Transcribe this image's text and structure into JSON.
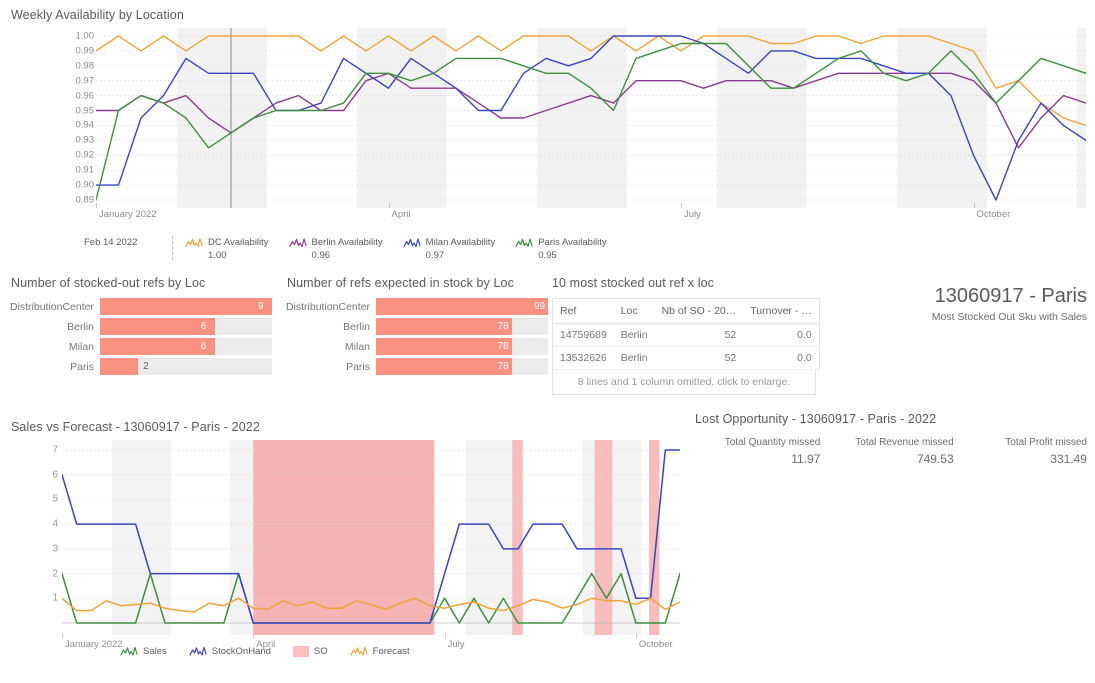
{
  "top_chart": {
    "title": "Weekly Availability by Location",
    "reference_date": "Feb 14 2022",
    "legend": [
      {
        "label": "DC Availability",
        "value": "1.00",
        "color": "#eda53a"
      },
      {
        "label": "Berlin Availability",
        "value": "0.96",
        "color": "#8a3d8f"
      },
      {
        "label": "Milan Availability",
        "value": "0.97",
        "color": "#3b44c4"
      },
      {
        "label": "Paris Availability",
        "value": "0.95",
        "color": "#3f8f3f"
      }
    ],
    "y_ticks": [
      "1.00",
      "0.99",
      "0.98",
      "0.97",
      "0.96",
      "0.95",
      "0.94",
      "0.93",
      "0.92",
      "0.91",
      "0.90",
      "0.89"
    ],
    "x_ticks": [
      "January 2022",
      "April",
      "July",
      "October"
    ]
  },
  "chart_data": [
    {
      "type": "line",
      "title": "Weekly Availability by Location",
      "xlabel": "",
      "ylabel": "",
      "ylim": [
        0.885,
        1.003
      ],
      "grid": true,
      "legend_position": "bottom",
      "x_tick_labels": [
        "January 2022",
        "April",
        "July",
        "October"
      ],
      "x_tick_positions": [
        0,
        13,
        26,
        39
      ],
      "reference_line_x": 6,
      "series": [
        {
          "name": "DC Availability",
          "color": "#eda53a",
          "values": [
            0.99,
            1.0,
            0.99,
            1.0,
            0.99,
            1.0,
            1.0,
            1.0,
            1.0,
            1.0,
            0.99,
            1.0,
            0.99,
            1.0,
            0.99,
            1.0,
            0.99,
            1.0,
            0.99,
            1.0,
            1.0,
            1.0,
            0.99,
            1.0,
            0.99,
            1.0,
            0.99,
            1.0,
            1.0,
            1.0,
            0.995,
            0.995,
            1.0,
            1.0,
            0.995,
            1.0,
            1.0,
            1.0,
            0.995,
            0.99,
            0.965,
            0.97,
            0.955,
            0.945,
            0.94
          ]
        },
        {
          "name": "Berlin Availability",
          "color": "#8a3d8f",
          "values": [
            0.95,
            0.95,
            0.96,
            0.955,
            0.96,
            0.945,
            0.935,
            0.945,
            0.955,
            0.96,
            0.95,
            0.95,
            0.97,
            0.975,
            0.965,
            0.965,
            0.965,
            0.955,
            0.945,
            0.945,
            0.95,
            0.955,
            0.96,
            0.955,
            0.97,
            0.97,
            0.97,
            0.965,
            0.97,
            0.97,
            0.97,
            0.965,
            0.97,
            0.975,
            0.975,
            0.975,
            0.975,
            0.975,
            0.975,
            0.97,
            0.955,
            0.925,
            0.945,
            0.96,
            0.955
          ]
        },
        {
          "name": "Milan Availability",
          "color": "#3b44c4",
          "values": [
            0.9,
            0.9,
            0.945,
            0.96,
            0.985,
            0.975,
            0.975,
            0.975,
            0.95,
            0.95,
            0.955,
            0.985,
            0.975,
            0.965,
            0.985,
            0.975,
            0.965,
            0.95,
            0.95,
            0.975,
            0.985,
            0.98,
            0.985,
            1.0,
            1.0,
            1.0,
            1.0,
            0.995,
            0.985,
            0.975,
            0.99,
            0.99,
            0.985,
            0.985,
            0.985,
            0.98,
            0.975,
            0.975,
            0.96,
            0.92,
            0.89,
            0.93,
            0.955,
            0.94,
            0.93
          ]
        },
        {
          "name": "Paris Availability",
          "color": "#3f8f3f",
          "values": [
            0.89,
            0.95,
            0.96,
            0.955,
            0.945,
            0.925,
            0.935,
            0.945,
            0.95,
            0.95,
            0.95,
            0.955,
            0.975,
            0.975,
            0.97,
            0.975,
            0.985,
            0.985,
            0.985,
            0.98,
            0.975,
            0.975,
            0.965,
            0.95,
            0.985,
            0.99,
            0.995,
            0.995,
            0.995,
            0.98,
            0.965,
            0.965,
            0.975,
            0.985,
            0.99,
            0.975,
            0.97,
            0.975,
            0.99,
            0.975,
            0.955,
            0.97,
            0.985,
            0.98,
            0.975
          ]
        }
      ]
    },
    {
      "type": "bar",
      "title": "Number of stocked-out refs by Loc",
      "orientation": "horizontal",
      "categories": [
        "DistributionCenter",
        "Berlin",
        "Milan",
        "Paris"
      ],
      "values": [
        9,
        6,
        6,
        2
      ],
      "max": 9,
      "bar_color": "#fb9180"
    },
    {
      "type": "bar",
      "title": "Number of refs expected in stock by Loc",
      "orientation": "horizontal",
      "categories": [
        "DistributionCenter",
        "Berlin",
        "Milan",
        "Paris"
      ],
      "values": [
        99,
        78,
        78,
        78
      ],
      "max": 99,
      "bar_color": "#fb9180"
    },
    {
      "type": "line",
      "title": "Sales vs Forecast - 13060917 - Paris - 2022",
      "ylim": [
        0,
        7.4
      ],
      "grid": true,
      "legend_position": "bottom",
      "x_tick_labels": [
        "January 2022",
        "April",
        "July",
        "October"
      ],
      "x_tick_positions": [
        0,
        13,
        26,
        39
      ],
      "shaded_regions": [
        {
          "name": "SO",
          "start": 13.0,
          "end": 25.3,
          "color": "#f4b3b3"
        },
        {
          "name": "SO",
          "start": 30.6,
          "end": 31.3,
          "color": "#f7bcbc"
        },
        {
          "name": "SO",
          "start": 36.2,
          "end": 37.4,
          "color": "#f7bcbc"
        },
        {
          "name": "SO",
          "start": 39.9,
          "end": 40.6,
          "color": "#f7bcbc"
        }
      ],
      "series": [
        {
          "name": "Sales",
          "color": "#3f8f3f",
          "values": [
            2,
            0,
            0,
            0,
            0,
            0,
            2,
            0,
            0,
            0,
            0,
            0,
            2,
            0,
            0,
            0,
            0,
            0,
            0,
            0,
            0,
            0,
            0,
            0,
            0,
            0,
            1,
            0,
            1,
            0,
            1,
            0,
            0,
            0,
            0,
            1,
            2,
            1,
            2,
            0,
            0,
            0,
            2
          ]
        },
        {
          "name": "StockOnHand",
          "color": "#3b44c4",
          "values": [
            6,
            4,
            4,
            4,
            4,
            4,
            2,
            2,
            2,
            2,
            2,
            2,
            2,
            0,
            0,
            0,
            0,
            0,
            0,
            0,
            0,
            0,
            0,
            0,
            0,
            0,
            2,
            4,
            4,
            4,
            3,
            3,
            4,
            4,
            4,
            3,
            3,
            3,
            3,
            1,
            1,
            7,
            7
          ]
        },
        {
          "name": "Forecast",
          "color": "#eda53a",
          "values": [
            1,
            0.5,
            0.5,
            0.9,
            0.7,
            0.75,
            0.8,
            0.6,
            0.5,
            0.45,
            0.8,
            0.7,
            1.0,
            0.6,
            0.55,
            0.9,
            0.7,
            0.85,
            0.6,
            0.6,
            0.9,
            0.75,
            0.55,
            0.8,
            1.0,
            0.7,
            0.6,
            0.75,
            0.85,
            0.6,
            0.5,
            0.7,
            0.95,
            0.85,
            0.6,
            0.75,
            1.0,
            0.9,
            0.9,
            0.75,
            1.0,
            0.55,
            0.85
          ]
        }
      ]
    }
  ],
  "bars_stocked_out": {
    "title": "Number of stocked-out refs by Loc",
    "rows": [
      {
        "label": "DistributionCenter",
        "value": "9",
        "pct": 100
      },
      {
        "label": "Berlin",
        "value": "6",
        "pct": 66.7
      },
      {
        "label": "Milan",
        "value": "6",
        "pct": 66.7
      },
      {
        "label": "Paris",
        "value": "2",
        "pct": 22.2
      }
    ]
  },
  "bars_expected": {
    "title": "Number of refs expected in stock by Loc",
    "rows": [
      {
        "label": "DistributionCenter",
        "value": "99",
        "pct": 100
      },
      {
        "label": "Berlin",
        "value": "78",
        "pct": 78.8
      },
      {
        "label": "Milan",
        "value": "78",
        "pct": 78.8
      },
      {
        "label": "Paris",
        "value": "78",
        "pct": 78.8
      }
    ]
  },
  "table": {
    "title": "10 most stocked out ref x loc",
    "columns": [
      "Ref",
      "Loc",
      "Nb of SO - 20…",
      "Turnover - …"
    ],
    "rows": [
      {
        "ref": "14759689",
        "loc": "Berlin",
        "nb_so": "52",
        "turnover": "0.0"
      },
      {
        "ref": "13532626",
        "loc": "Berlin",
        "nb_so": "52",
        "turnover": "0.0"
      }
    ],
    "footnote": "8 lines and 1 column omitted, click to enlarge."
  },
  "sku_header": {
    "title": "13060917 - Paris",
    "subtitle": "Most Stocked Out Sku with Sales"
  },
  "bottom_chart": {
    "title": "Sales vs Forecast - 13060917 - Paris - 2022",
    "y_ticks": [
      "7",
      "6",
      "5",
      "4",
      "3",
      "2",
      "1"
    ],
    "x_ticks": [
      "January 2022",
      "April",
      "July",
      "October"
    ],
    "legend": [
      {
        "label": "Sales",
        "color": "#3f8f3f",
        "kind": "line"
      },
      {
        "label": "StockOnHand",
        "color": "#3b44c4",
        "kind": "line"
      },
      {
        "label": "SO",
        "color": "#fbbfbf",
        "kind": "area"
      },
      {
        "label": "Forecast",
        "color": "#eda53a",
        "kind": "line"
      }
    ]
  },
  "lost_opportunity": {
    "title": "Lost Opportunity - 13060917 - Paris - 2022",
    "metrics": [
      {
        "label": "Total Quantity missed",
        "value": "11.97"
      },
      {
        "label": "Total Revenue missed",
        "value": "749.53"
      },
      {
        "label": "Total Profit missed",
        "value": "331.49"
      }
    ]
  }
}
